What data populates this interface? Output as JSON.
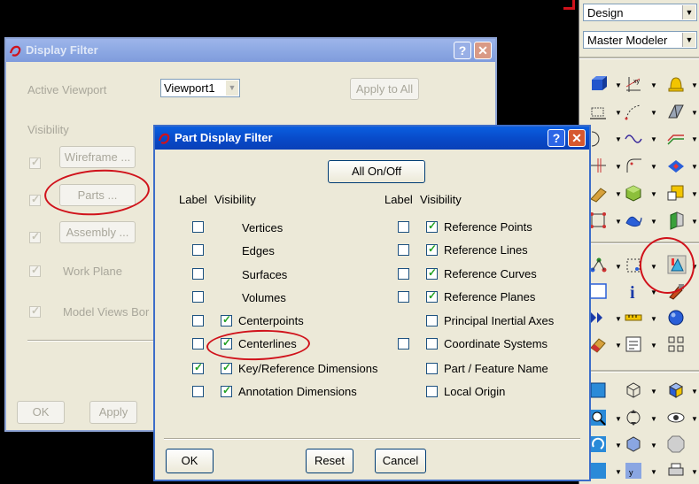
{
  "toolbar_panel": {
    "combo1": "Design",
    "combo2": "Master Modeler"
  },
  "display_filter": {
    "title": "Display Filter",
    "active_viewport_label": "Active Viewport",
    "viewport_value": "Viewport1",
    "apply_all": "Apply to All",
    "visibility_label": "Visibility",
    "wireframe": "Wireframe ...",
    "parts": "Parts ...",
    "assembly": "Assembly ...",
    "work_plane": "Work Plane",
    "model_views": "Model Views Bor",
    "ok": "OK",
    "apply": "Apply"
  },
  "part_filter": {
    "title": "Part Display Filter",
    "all_onoff": "All On/Off",
    "col_label": "Label",
    "col_visibility": "Visibility",
    "left_items": [
      {
        "label": "Vertices",
        "label_checked": false,
        "vis_checked": null
      },
      {
        "label": "Edges",
        "label_checked": false,
        "vis_checked": null
      },
      {
        "label": "Surfaces",
        "label_checked": false,
        "vis_checked": null
      },
      {
        "label": "Volumes",
        "label_checked": false,
        "vis_checked": null
      },
      {
        "label": "Centerpoints",
        "label_checked": false,
        "vis_checked": true
      },
      {
        "label": "Centerlines",
        "label_checked": false,
        "vis_checked": true
      },
      {
        "label": "Key/Reference Dimensions",
        "label_checked": true,
        "vis_checked": true
      },
      {
        "label": "Annotation Dimensions",
        "label_checked": false,
        "vis_checked": true
      }
    ],
    "right_items": [
      {
        "label": "Reference Points",
        "label_checked": false,
        "vis_checked": true
      },
      {
        "label": "Reference Lines",
        "label_checked": false,
        "vis_checked": true
      },
      {
        "label": "Reference Curves",
        "label_checked": false,
        "vis_checked": true
      },
      {
        "label": "Reference Planes",
        "label_checked": false,
        "vis_checked": true
      },
      {
        "label": "Principal Inertial Axes",
        "label_checked": null,
        "vis_checked": false
      },
      {
        "label": "Coordinate Systems",
        "label_checked": false,
        "vis_checked": false
      },
      {
        "label": "Part / Feature Name",
        "label_checked": null,
        "vis_checked": false
      },
      {
        "label": "Local Origin",
        "label_checked": null,
        "vis_checked": false
      }
    ],
    "ok": "OK",
    "reset": "Reset",
    "cancel": "Cancel"
  },
  "colors": {
    "title_active": "#0848c6",
    "title_inactive": "#8aa6e2",
    "dialog_bg": "#ece9d8",
    "annotation_red": "#d0121b",
    "check_green": "#21a121"
  }
}
